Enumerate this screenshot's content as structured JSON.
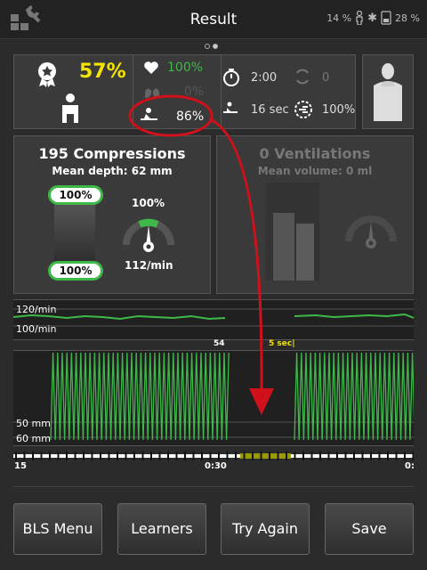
{
  "header": {
    "title": "Result",
    "battery1": "14 %",
    "battery2": "28 %"
  },
  "summary": {
    "score": "57%",
    "heart_pct": "100%",
    "lungs_pct": "0%",
    "cpr_pct": "86%",
    "time": "2:00",
    "cycles": "0",
    "hands_off": "16 sec",
    "flow_fraction": "100%"
  },
  "compressions": {
    "title": "195 Compressions",
    "mean_depth": "Mean depth: 62 mm",
    "top_pct": "100%",
    "bottom_pct": "100%",
    "rate_pct": "100%",
    "rate": "112/min"
  },
  "ventilations": {
    "title": "0 Ventilations",
    "mean_volume": "Mean volume: 0 ml"
  },
  "rate_chart": {
    "label_top": "120/min",
    "label_bottom": "100/min",
    "marker_count": "54",
    "marker_time": "5 sec|"
  },
  "depth_chart": {
    "label_top": "50 mm",
    "label_bottom": "60 mm"
  },
  "timeline": {
    "t_start": "15",
    "t_mid": "0:30",
    "t_end": "0:"
  },
  "buttons": {
    "bls_menu": "BLS Menu",
    "learners": "Learners",
    "try_again": "Try Again",
    "save": "Save"
  },
  "colors": {
    "green": "#3fb84a",
    "yellow": "#f4e400",
    "red": "#d0101a"
  }
}
